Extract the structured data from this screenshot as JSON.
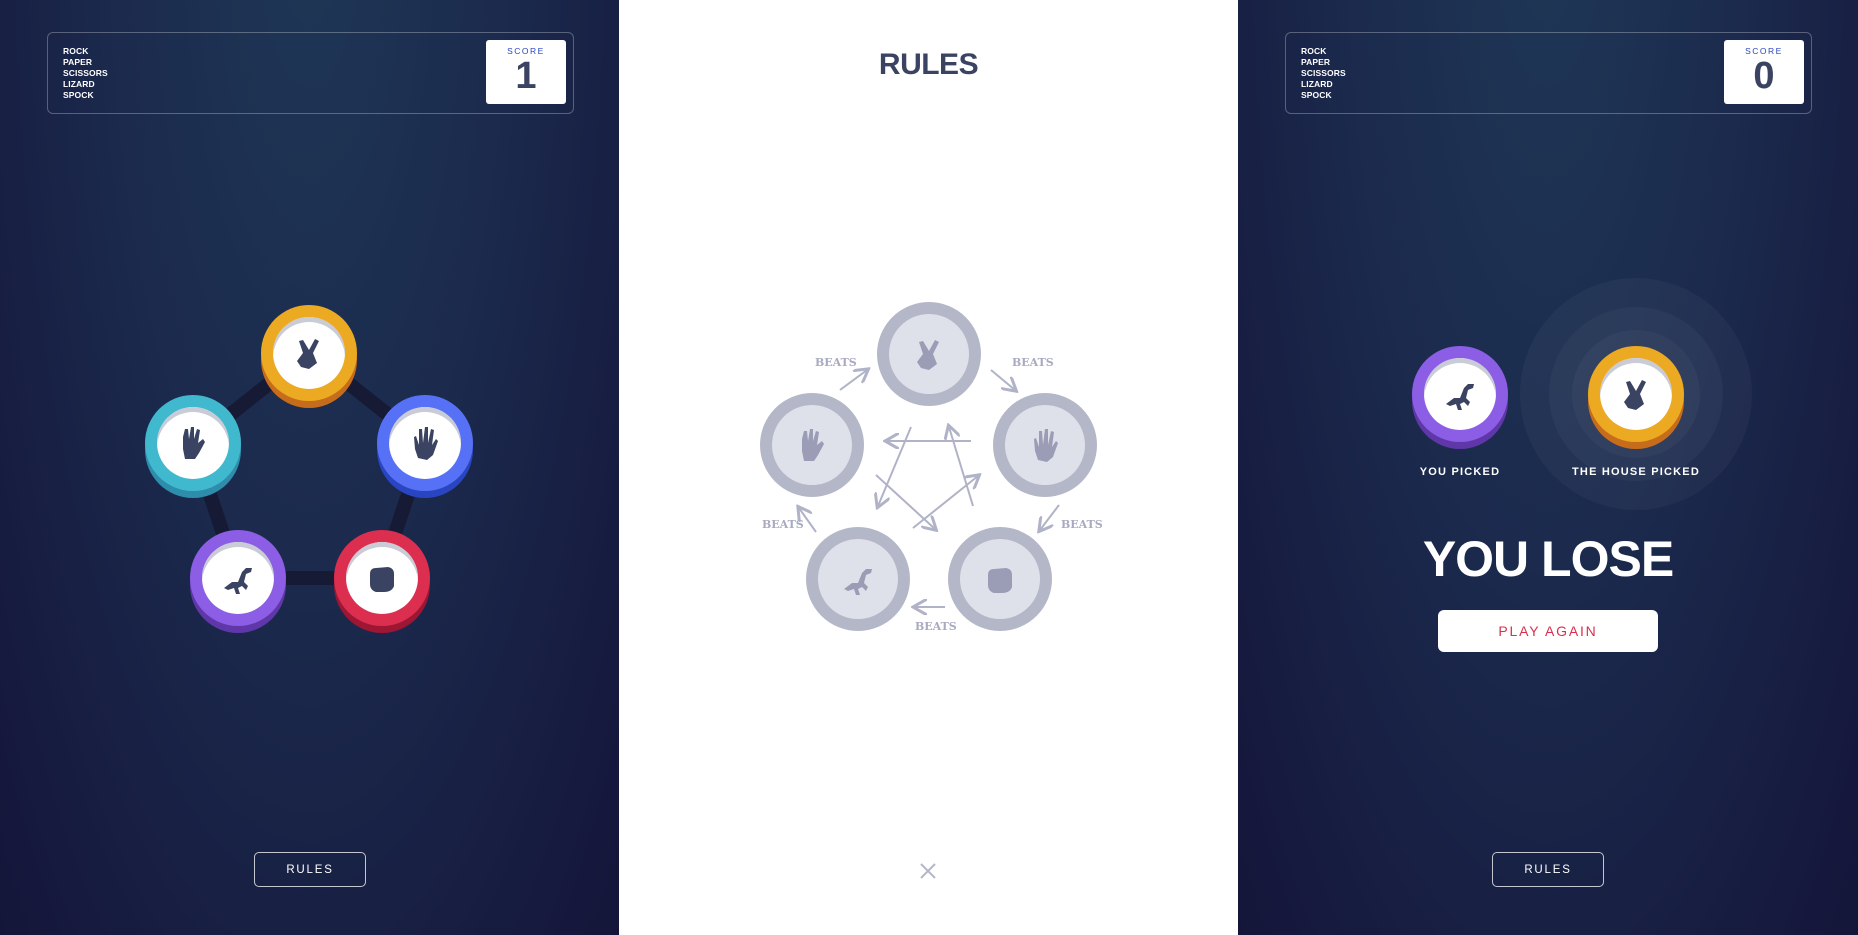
{
  "header": {
    "title_lines": [
      "ROCK",
      "PAPER",
      "SCISSORS",
      "LIZARD",
      "SPOCK"
    ],
    "score_label": "SCORE"
  },
  "left_panel": {
    "score": "1",
    "rules_button_label": "RULES",
    "tokens": [
      {
        "name": "scissors",
        "icon": "scissors-icon",
        "color": "#eca922",
        "shadow": "#c76c1b"
      },
      {
        "name": "spock",
        "icon": "spock-icon",
        "color": "#40b9ce",
        "shadow": "#2d8dab"
      },
      {
        "name": "paper",
        "icon": "paper-icon",
        "color": "#5671f5",
        "shadow": "#2a45c2"
      },
      {
        "name": "lizard",
        "icon": "lizard-icon",
        "color": "#8c5de5",
        "shadow": "#5f37a8"
      },
      {
        "name": "rock",
        "icon": "rock-icon",
        "color": "#dc2e4e",
        "shadow": "#9d1634"
      }
    ]
  },
  "rules_modal": {
    "title": "RULES",
    "beats_label": "BEATS",
    "close_icon": "close-icon"
  },
  "right_panel": {
    "score": "0",
    "rules_button_label": "RULES",
    "you_picked_label": "YOU PICKED",
    "house_picked_label": "THE HOUSE PICKED",
    "you_picked": "lizard",
    "house_picked": "scissors",
    "result_text": "YOU LOSE",
    "play_again_label": "PLAY AGAIN"
  },
  "colors": {
    "bg_dark": "#141539",
    "bg_light": "#1f3756",
    "score_text": "#3b4363",
    "score_label": "#2a46c0",
    "play_again_text": "#db2e4d"
  }
}
